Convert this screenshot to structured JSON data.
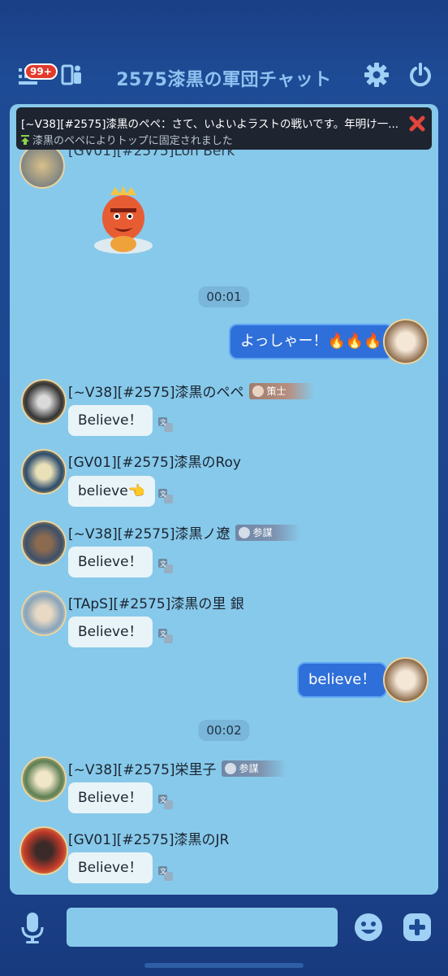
{
  "header": {
    "title": "2575漆黒の軍団チャット",
    "badge": "99+",
    "icons": [
      "list-icon",
      "members-icon",
      "gear-icon",
      "power-icon"
    ]
  },
  "pinned": {
    "message": "[~V38][#2575]漆黒のペペ：さて、いよいよラストの戦いです。年明け一...",
    "note": "漆黒のペペによりトップに固定されました"
  },
  "messages": {
    "top_partial_name": "[GV01][#2575]Lon Berk",
    "ts1": "00:01",
    "my1": "よっしゃー！🔥🔥🔥",
    "m1": {
      "name": "[~V38][#2575]漆黒のペペ",
      "rank": "策士",
      "text": "Believe！"
    },
    "m2": {
      "name": "[GV01][#2575]漆黒のRoy",
      "text": "believe👈"
    },
    "m3": {
      "name": "[~V38][#2575]漆黒ノ遼",
      "rank": "参謀",
      "text": "Believe！"
    },
    "m4": {
      "name": "[TApS][#2575]漆黒の里 銀",
      "text": "Believe！"
    },
    "my2": "believe！",
    "ts2": "00:02",
    "m5": {
      "name": "[~V38][#2575]栄里子",
      "rank": "参謀",
      "text": "Believe！"
    },
    "m6": {
      "name": "[GV01][#2575]漆黒のJR",
      "text": "Believe！"
    }
  },
  "input": {
    "value": ""
  },
  "colors": {
    "panel": "#87c9ea",
    "myBubble": "#2f6fd9",
    "header": "#1e4b95"
  }
}
